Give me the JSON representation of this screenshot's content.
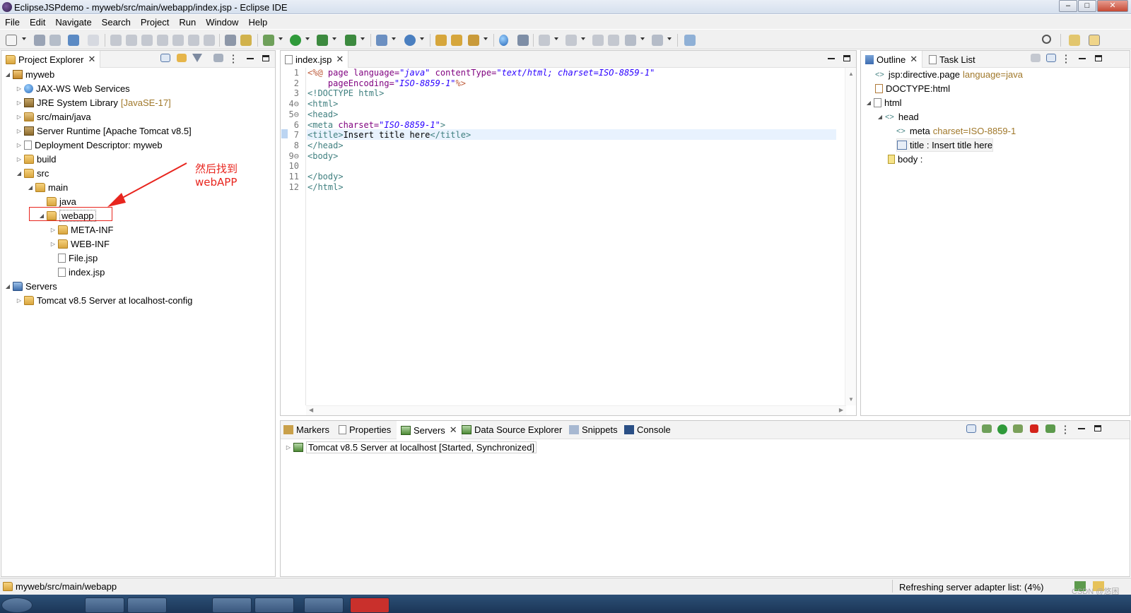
{
  "window": {
    "title": "EclipseJSPdemo - myweb/src/main/webapp/index.jsp - Eclipse IDE",
    "min": "–",
    "max": "□",
    "close": "✕"
  },
  "menu": [
    "File",
    "Edit",
    "Navigate",
    "Search",
    "Project",
    "Run",
    "Window",
    "Help"
  ],
  "project_explorer": {
    "tab_label": "Project Explorer",
    "tree": [
      {
        "label": "myweb",
        "depth": 0,
        "twisty": "◢"
      },
      {
        "label": "JAX-WS Web Services",
        "depth": 1,
        "twisty": "▷"
      },
      {
        "label": "JRE System Library",
        "suffix": "[JavaSE-17]",
        "depth": 1,
        "twisty": "▷"
      },
      {
        "label": "src/main/java",
        "depth": 1,
        "twisty": "▷"
      },
      {
        "label": "Server Runtime [Apache Tomcat v8.5]",
        "depth": 1,
        "twisty": "▷"
      },
      {
        "label": "Deployment Descriptor: myweb",
        "depth": 1,
        "twisty": "▷"
      },
      {
        "label": "build",
        "depth": 1,
        "twisty": "▷"
      },
      {
        "label": "src",
        "depth": 1,
        "twisty": "◢"
      },
      {
        "label": "main",
        "depth": 2,
        "twisty": "◢"
      },
      {
        "label": "java",
        "depth": 3,
        "twisty": ""
      },
      {
        "label": "webapp",
        "depth": 3,
        "twisty": "◢"
      },
      {
        "label": "META-INF",
        "depth": 4,
        "twisty": "▷"
      },
      {
        "label": "WEB-INF",
        "depth": 4,
        "twisty": "▷"
      },
      {
        "label": "File.jsp",
        "depth": 4,
        "twisty": ""
      },
      {
        "label": "index.jsp",
        "depth": 4,
        "twisty": ""
      },
      {
        "label": "Servers",
        "depth": 0,
        "twisty": "◢"
      },
      {
        "label": "Tomcat v8.5 Server at localhost-config",
        "depth": 1,
        "twisty": "▷"
      }
    ],
    "annotation": "然后找到webAPP"
  },
  "editor": {
    "tab_label": "index.jsp",
    "line_numbers": [
      "1",
      "2",
      "3",
      "4⊖",
      "5⊖",
      "6",
      "7",
      "8",
      "9⊖",
      "10",
      "11",
      "12"
    ],
    "lines": [
      {
        "a": "<%@ ",
        "b": "page ",
        "c": "language=",
        "d": "\"java\"",
        "e": " contentType=",
        "f": "\"text/html; charset=ISO-8859-1\""
      },
      {
        "a": "    pageEncoding=",
        "b": "\"ISO-8859-1\"",
        "c": "%>"
      },
      {
        "a": "<!DOCTYPE html>"
      },
      {
        "a": "<html>"
      },
      {
        "a": "<head>"
      },
      {
        "a": "<meta ",
        "b": "charset=",
        "c": "\"ISO-8859-1\"",
        "d": ">"
      },
      {
        "a": "<title>",
        "b": "Insert title here",
        "c": "</title>"
      },
      {
        "a": "</head>"
      },
      {
        "a": "<body>"
      },
      {
        "a": ""
      },
      {
        "a": "</body>"
      },
      {
        "a": "</html>"
      }
    ]
  },
  "outline": {
    "tab_label": "Outline",
    "task_tab_label": "Task List",
    "items": [
      {
        "label": "jsp:directive.page",
        "suffix": "language=java"
      },
      {
        "label": "DOCTYPE:html",
        "suffix": ""
      },
      {
        "label": "html",
        "suffix": ""
      },
      {
        "label": "head",
        "suffix": ""
      },
      {
        "label": "meta",
        "suffix": "charset=ISO-8859-1"
      },
      {
        "label": "title : Insert title here",
        "suffix": ""
      },
      {
        "label": "body :",
        "suffix": ""
      }
    ]
  },
  "bottom": {
    "tabs": [
      "Markers",
      "Properties",
      "Servers",
      "Data Source Explorer",
      "Snippets",
      "Console"
    ],
    "server_row": "Tomcat v8.5 Server at localhost  [Started, Synchronized]"
  },
  "status": {
    "path": "myweb/src/main/webapp",
    "progress_text": "Refreshing server adapter list: (4%)",
    "progress": 0.04,
    "watermark": "CSDN @悠困"
  },
  "colors": {
    "accent_red": "#e8251e",
    "tag": "#3f7f7f",
    "attr": "#7f007f",
    "value": "#2a00ff"
  }
}
